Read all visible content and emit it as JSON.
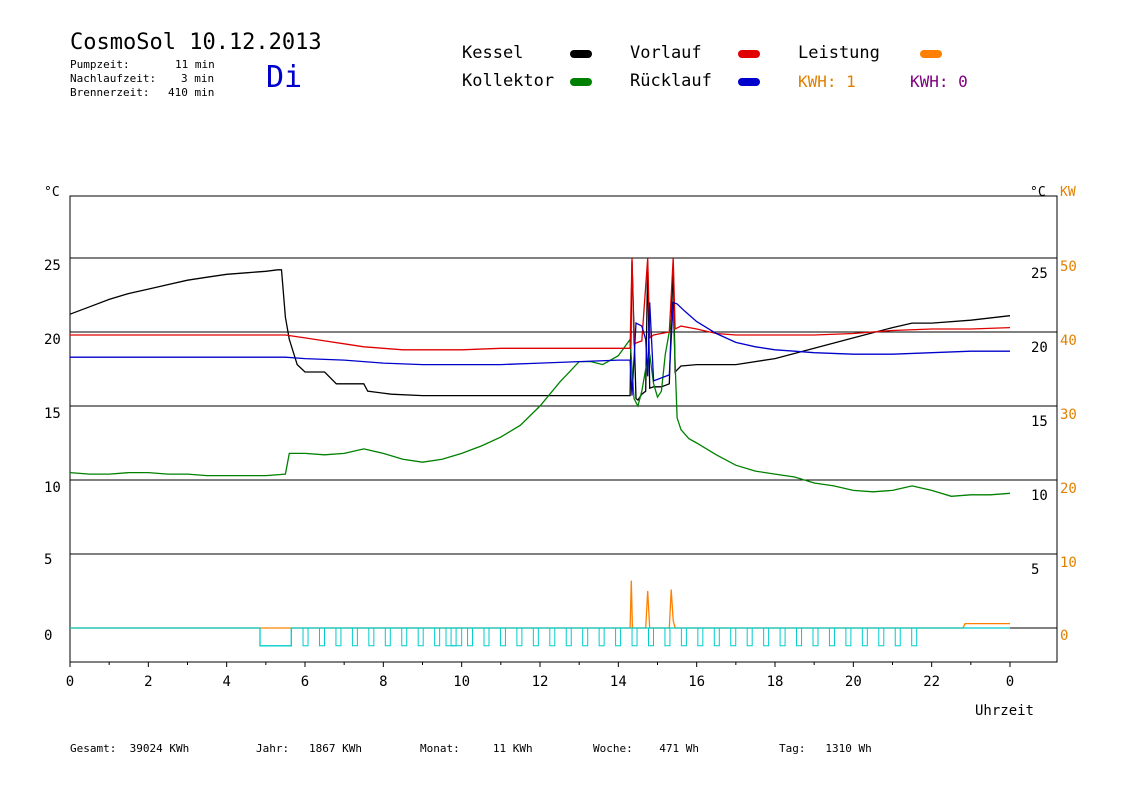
{
  "header": {
    "title": "CosmoSol 10.12.2013",
    "day": "Di",
    "stats": [
      {
        "label": "Pumpzeit:",
        "value": "11 min"
      },
      {
        "label": "Nachlaufzeit:",
        "value": "3 min"
      },
      {
        "label": "Brennerzeit:",
        "value": "410 min"
      }
    ]
  },
  "legend": {
    "items": [
      {
        "label": "Kessel",
        "color": "#000000"
      },
      {
        "label": "Kollektor",
        "color": "#008000"
      },
      {
        "label": "Vorlauf",
        "color": "#e00000"
      },
      {
        "label": "Rücklauf",
        "color": "#0000cc"
      },
      {
        "label": "Leistung",
        "color": "#ff8000"
      }
    ],
    "kwh1": "KWH: 1",
    "kwh0": "KWH: 0",
    "kwh1_color": "#e08000",
    "kwh0_color": "#800080"
  },
  "footer": {
    "gesamt": "Gesamt:  39024 KWh",
    "jahr": "Jahr:   1867 KWh",
    "monat": "Monat:     11 KWh",
    "woche": "Woche:    471 Wh",
    "tag": "Tag:   1310 Wh"
  },
  "chart_data": {
    "type": "line",
    "xlabel": "Uhrzeit",
    "ylabel_left": "°C",
    "ylabel_right": "°C",
    "ylabel_right2": "KW",
    "x_ticks": [
      "0",
      "2",
      "4",
      "6",
      "8",
      "10",
      "12",
      "14",
      "16",
      "18",
      "20",
      "22",
      "0"
    ],
    "y_ticks_left": [
      "25",
      "20",
      "15",
      "10",
      "5",
      "0"
    ],
    "y_ticks_right": [
      "25",
      "20",
      "15",
      "10",
      "5"
    ],
    "y_ticks_kw": [
      "50",
      "40",
      "30",
      "20",
      "10",
      "0"
    ],
    "xlim": [
      0,
      24
    ],
    "ylim": [
      -2.4,
      27
    ],
    "grid_y": [
      25,
      20,
      15,
      10,
      5,
      0
    ],
    "series": [
      {
        "name": "Kessel",
        "color": "#000000",
        "x": [
          0,
          0.5,
          1,
          1.5,
          2,
          2.5,
          3,
          3.5,
          4,
          4.5,
          5,
          5.3,
          5.4,
          5.5,
          5.6,
          5.8,
          6.0,
          6.5,
          6.8,
          7.5,
          7.6,
          8.2,
          9.0,
          10,
          11,
          12,
          13,
          14.0,
          14.3,
          14.35,
          14.45,
          14.5,
          14.6,
          14.7,
          14.75,
          14.8,
          14.9,
          15.1,
          15.3,
          15.4,
          15.45,
          15.6,
          16.0,
          17,
          18,
          19,
          20,
          21,
          21.5,
          22,
          23,
          24
        ],
        "y": [
          21.2,
          21.7,
          22.2,
          22.6,
          22.9,
          23.2,
          23.5,
          23.7,
          23.9,
          24.0,
          24.1,
          24.2,
          24.2,
          21.0,
          19.5,
          17.8,
          17.3,
          17.3,
          16.5,
          16.5,
          16.0,
          15.8,
          15.7,
          15.7,
          15.7,
          15.7,
          15.7,
          15.7,
          15.7,
          24.8,
          15.5,
          15.4,
          15.8,
          16.0,
          24.8,
          16.2,
          16.3,
          16.3,
          16.5,
          24.6,
          17.3,
          17.7,
          17.8,
          17.8,
          18.2,
          18.9,
          19.6,
          20.3,
          20.6,
          20.6,
          20.8,
          21.1
        ]
      },
      {
        "name": "Kollektor",
        "color": "#008000",
        "x": [
          0,
          0.5,
          1,
          1.5,
          2,
          2.5,
          3,
          3.5,
          4,
          4.5,
          5,
          5.5,
          5.6,
          6.0,
          6.5,
          7.0,
          7.5,
          8.0,
          8.5,
          9.0,
          9.5,
          10,
          10.5,
          11,
          11.5,
          12,
          12.5,
          13,
          13.3,
          13.6,
          14.0,
          14.3,
          14.4,
          14.5,
          14.6,
          14.7,
          14.8,
          14.9,
          15.0,
          15.1,
          15.2,
          15.4,
          15.5,
          15.6,
          15.8,
          16.0,
          16.5,
          17.0,
          17.5,
          18.0,
          18.5,
          19.0,
          19.5,
          20.0,
          20.5,
          21.0,
          21.5,
          22.0,
          22.5,
          23.0,
          23.5,
          24.0
        ],
        "y": [
          10.5,
          10.4,
          10.4,
          10.5,
          10.5,
          10.4,
          10.4,
          10.3,
          10.3,
          10.3,
          10.3,
          10.4,
          11.8,
          11.8,
          11.7,
          11.8,
          12.1,
          11.8,
          11.4,
          11.2,
          11.4,
          11.8,
          12.3,
          12.9,
          13.7,
          15.0,
          16.6,
          18.0,
          18.0,
          17.8,
          18.4,
          19.5,
          15.5,
          15.0,
          16.0,
          17.5,
          18.5,
          16.5,
          15.6,
          16.0,
          18.5,
          21.5,
          14.2,
          13.4,
          12.8,
          12.5,
          11.7,
          11.0,
          10.6,
          10.4,
          10.2,
          9.8,
          9.6,
          9.3,
          9.2,
          9.3,
          9.6,
          9.3,
          8.9,
          9.0,
          9.0,
          9.1
        ]
      },
      {
        "name": "Vorlauf",
        "color": "#e00000",
        "x": [
          0,
          1,
          2,
          3,
          4,
          5,
          5.5,
          6,
          6.5,
          7,
          7.5,
          8,
          8.5,
          9,
          10,
          11,
          12,
          13,
          14,
          14.3,
          14.35,
          14.4,
          14.6,
          14.75,
          14.8,
          14.9,
          15.3,
          15.4,
          15.45,
          15.6,
          16,
          16.5,
          17,
          18,
          19,
          20,
          21,
          22,
          23,
          24
        ],
        "y": [
          19.8,
          19.8,
          19.8,
          19.8,
          19.8,
          19.8,
          19.8,
          19.6,
          19.4,
          19.2,
          19.0,
          18.9,
          18.8,
          18.8,
          18.8,
          18.9,
          18.9,
          18.9,
          18.9,
          18.9,
          25.0,
          19.2,
          19.4,
          25.0,
          19.6,
          19.8,
          20.0,
          25.0,
          20.2,
          20.4,
          20.2,
          19.9,
          19.8,
          19.8,
          19.8,
          19.9,
          20.1,
          20.2,
          20.2,
          20.3
        ]
      },
      {
        "name": "Rücklauf",
        "color": "#0000cc",
        "x": [
          0,
          1,
          2,
          3,
          4,
          5,
          5.5,
          6,
          7,
          8,
          9,
          10,
          11,
          12,
          13,
          14,
          14.3,
          14.35,
          14.45,
          14.6,
          14.7,
          14.75,
          14.8,
          14.9,
          15.0,
          15.3,
          15.4,
          15.5,
          15.7,
          16.0,
          16.5,
          17.0,
          17.5,
          18.0,
          18.5,
          19.0,
          20,
          21,
          22,
          23,
          24
        ],
        "y": [
          18.3,
          18.3,
          18.3,
          18.3,
          18.3,
          18.3,
          18.3,
          18.2,
          18.1,
          17.9,
          17.8,
          17.8,
          17.8,
          17.9,
          18.0,
          18.1,
          18.1,
          15.7,
          20.6,
          20.4,
          19.5,
          17.0,
          22.0,
          16.7,
          16.8,
          17.1,
          22.0,
          21.9,
          21.4,
          20.7,
          19.9,
          19.3,
          19.0,
          18.8,
          18.7,
          18.6,
          18.5,
          18.5,
          18.6,
          18.7,
          18.7
        ]
      },
      {
        "name": "Leistung",
        "color": "#ff8000",
        "x": [
          0,
          14.3,
          14.33,
          14.36,
          14.4,
          14.7,
          14.75,
          14.8,
          14.85,
          15.3,
          15.35,
          15.4,
          15.45,
          15.5,
          22.8,
          22.85,
          24
        ],
        "y": [
          0,
          0,
          3.2,
          0,
          0,
          0,
          2.5,
          0,
          0,
          0,
          2.6,
          0.5,
          0,
          0,
          0,
          0.3,
          0.3
        ]
      },
      {
        "name": "Pumpe",
        "color": "#00cccc",
        "x": [
          0,
          4.85,
          4.85,
          5.65,
          5.65,
          22.5,
          24
        ],
        "y": [
          0,
          0,
          -1.2,
          -1.2,
          0,
          0,
          0
        ]
      }
    ]
  }
}
